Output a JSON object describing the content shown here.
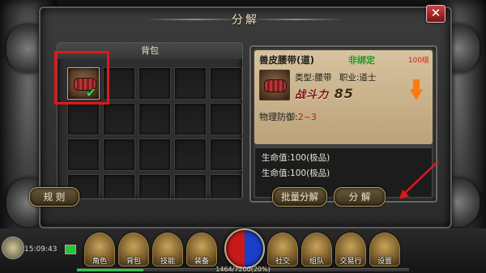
{
  "window": {
    "title": "分解",
    "close_label": "✕"
  },
  "bag": {
    "tab_label": "背包"
  },
  "item": {
    "name": "兽皮腰带(道)",
    "bind_status": "非绑定",
    "level_badge": "100级",
    "type": "类型:腰带",
    "profession": "职业:道士",
    "power_label": "战斗力",
    "power_value": "85",
    "phys_def_label": "物理防御:",
    "phys_def_value": "2~3",
    "stats": [
      "生命值:100(极品)",
      "生命值:100(极品)"
    ]
  },
  "buttons": {
    "rules": "规 则",
    "batch": "批量分解",
    "decompose": "分 解"
  },
  "hud": {
    "clock": "15:09:43",
    "menu": [
      "角色",
      "背包",
      "技能",
      "装备",
      "社交",
      "组队",
      "交易行",
      "设置"
    ],
    "exp_text": "1464/7200(20%)",
    "exp_fraction": 0.2
  },
  "colors": {
    "highlight": "#e11818",
    "bind_green": "#1e9a2a",
    "hp_red": "#c81a1a",
    "mp_blue": "#1a3fc8"
  }
}
